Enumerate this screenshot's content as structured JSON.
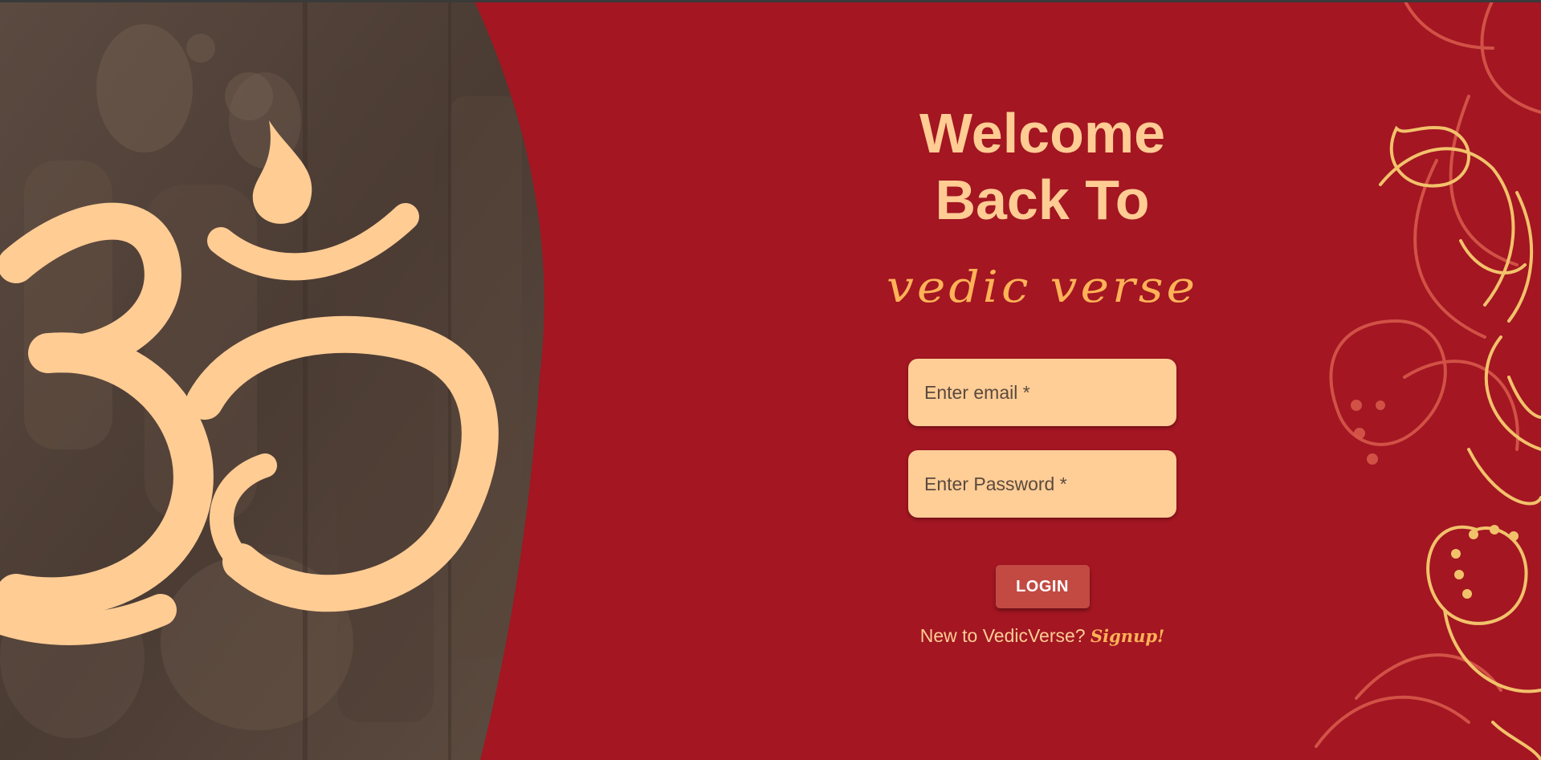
{
  "login": {
    "heading_line1": "Welcome",
    "heading_line2": "Back To",
    "brand": "vedic verse",
    "email_placeholder": "Enter email *",
    "password_placeholder": "Enter Password *",
    "login_label": "LOGIN",
    "signup_prompt": "New to VedicVerse?",
    "signup_link": "Signup!"
  },
  "hero": {
    "symbol_icon": "om-symbol-icon",
    "background": "carved-stone-temple-image"
  },
  "decoration": {
    "ornament_icon": "paisley-ornament-icon"
  },
  "colors": {
    "background": "#a31622",
    "heading": "#ffcc94",
    "brand": "#ffb257",
    "field": "#ffcd96",
    "button": "#c24a42",
    "ornament_gold": "#f2c26b",
    "ornament_red": "#d8584a"
  }
}
